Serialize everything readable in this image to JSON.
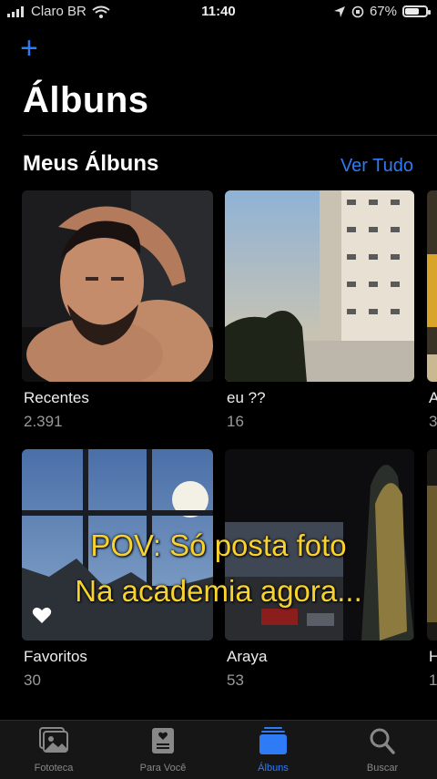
{
  "status_bar": {
    "carrier": "Claro BR",
    "time": "11:40",
    "battery": "67%",
    "battery_level": 0.67
  },
  "header": {
    "title": "Álbuns"
  },
  "section": {
    "title": "Meus Álbuns",
    "see_all": "Ver Tudo"
  },
  "albums": [
    {
      "name": "Recentes",
      "count": "2.391"
    },
    {
      "name": "eu ??",
      "count": "16"
    },
    {
      "name": "A",
      "count": "3"
    },
    {
      "name": "Favoritos",
      "count": "30"
    },
    {
      "name": "Araya",
      "count": "53"
    },
    {
      "name": "H",
      "count": "1"
    }
  ],
  "caption": {
    "line1": "POV:  Só posta foto",
    "line2": "Na academia agora..."
  },
  "tabs": [
    {
      "label": "Fototeca"
    },
    {
      "label": "Para Você"
    },
    {
      "label": "Álbuns"
    },
    {
      "label": "Buscar"
    }
  ],
  "colors": {
    "accent": "#2f7bf5",
    "caption": "#f8d22f",
    "tab_bar": "#161616"
  }
}
